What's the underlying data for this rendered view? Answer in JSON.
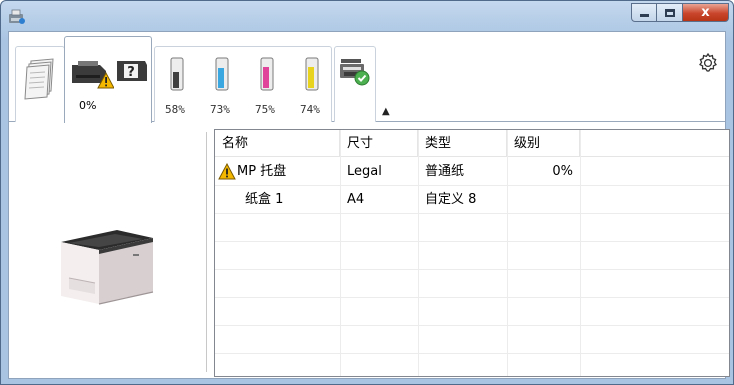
{
  "window": {
    "title": "",
    "colors": {
      "frame": "#a9c4e2",
      "close": "#c9462c",
      "warning": "#f5b800"
    }
  },
  "caption_buttons": {
    "close_label": "x"
  },
  "toolbar": {
    "tabs": [
      {
        "id": "paper",
        "icon": "paper-stack-icon"
      },
      {
        "id": "status",
        "icon": "printer-warning-icon",
        "label": "0%"
      },
      {
        "id": "toner",
        "icon": "toner-cartridge-icon"
      },
      {
        "id": "device",
        "icon": "device-settings-icon"
      }
    ],
    "status_percent": "0%",
    "toner": [
      {
        "color": "black",
        "hex": "#404040",
        "level": 0.58,
        "label": "58%"
      },
      {
        "color": "cyan",
        "hex": "#3aa7e0",
        "level": 0.73,
        "label": "73%"
      },
      {
        "color": "magenta",
        "hex": "#e0449a",
        "level": 0.75,
        "label": "75%"
      },
      {
        "color": "yellow",
        "hex": "#e8d41e",
        "level": 0.74,
        "label": "74%"
      }
    ],
    "collapse_glyph": "▲",
    "settings_icon": "gear-icon"
  },
  "table": {
    "columns": [
      "名称",
      "尺寸",
      "类型",
      "级别"
    ],
    "rows": [
      {
        "warning": true,
        "name": "MP 托盘",
        "size": "Legal",
        "type": "普通纸",
        "level": "0%"
      },
      {
        "warning": false,
        "name": "纸盒 1",
        "size": "A4",
        "type": "自定义 8",
        "level": ""
      }
    ]
  }
}
